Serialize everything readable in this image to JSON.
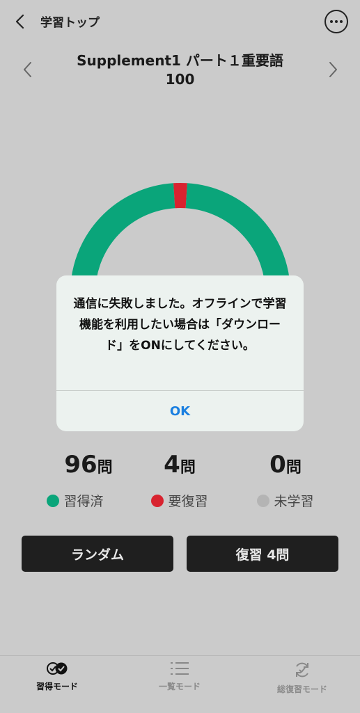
{
  "header": {
    "back_label": "学習トップ",
    "set_title": "Supplement1 パート１重要語100"
  },
  "gauge": {
    "mastered": 96,
    "review": 4,
    "unlearned": 0
  },
  "stats": [
    {
      "value": "96",
      "unit": "問",
      "label": "習得済",
      "color": "#0aa57a"
    },
    {
      "value": "4",
      "unit": "問",
      "label": "要復習",
      "color": "#d8232f"
    },
    {
      "value": "0",
      "unit": "問",
      "label": "未学習",
      "color": "#b4b4b4"
    }
  ],
  "buttons": {
    "random": "ランダム",
    "review": "復習 4問"
  },
  "tabs": [
    {
      "label": "習得モード"
    },
    {
      "label": "一覧モード"
    },
    {
      "label": "総復習モード"
    }
  ],
  "dialog": {
    "message": "通信に失敗しました。オフラインで学習機能を利用したい場合は「ダウンロード」をONにしてください。",
    "ok": "OK"
  },
  "colors": {
    "mastered": "#0aa57a",
    "review": "#d8232f",
    "unlearned": "#b4b4b4"
  }
}
